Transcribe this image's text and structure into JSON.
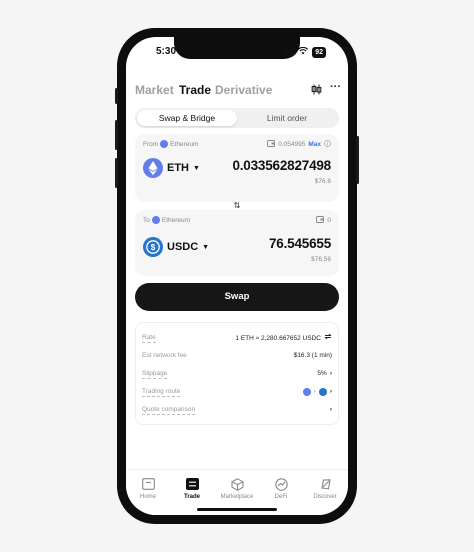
{
  "status": {
    "time": "5:30",
    "battery": "92"
  },
  "topnav": {
    "tabs": [
      "Market",
      "Trade",
      "Derivative"
    ],
    "active": "Trade"
  },
  "segment": {
    "options": [
      "Swap & Bridge",
      "Limit order"
    ],
    "active": "Swap & Bridge"
  },
  "from": {
    "label": "From",
    "network": "Ethereum",
    "balance": "0.054995",
    "max_label": "Max",
    "token": "ETH",
    "amount": "0.033562827498",
    "fiat": "$76.6"
  },
  "to": {
    "label": "To",
    "network": "Ethereum",
    "balance": "0",
    "token": "USDC",
    "amount": "76.545655",
    "fiat": "$76.56"
  },
  "swap_button": "Swap",
  "details": {
    "rate_label": "Rate",
    "rate_value": "1 ETH ≈ 2,280.667652 USDC",
    "fee_label": "Est network fee",
    "fee_value": "$16.3 (1 min)",
    "slippage_label": "Slippage",
    "slippage_value": "5%",
    "route_label": "Trading route",
    "quote_label": "Quote comparison"
  },
  "bottomnav": [
    {
      "label": "Home",
      "icon": "wallet-icon"
    },
    {
      "label": "Trade",
      "icon": "trade-icon"
    },
    {
      "label": "Marketplace",
      "icon": "marketplace-icon"
    },
    {
      "label": "DeFi",
      "icon": "defi-icon"
    },
    {
      "label": "Discover",
      "icon": "discover-icon"
    }
  ],
  "colors": {
    "accent": "#3a6ff7",
    "eth": "#627eea",
    "usdc": "#2775ca",
    "primary_button": "#161616"
  }
}
